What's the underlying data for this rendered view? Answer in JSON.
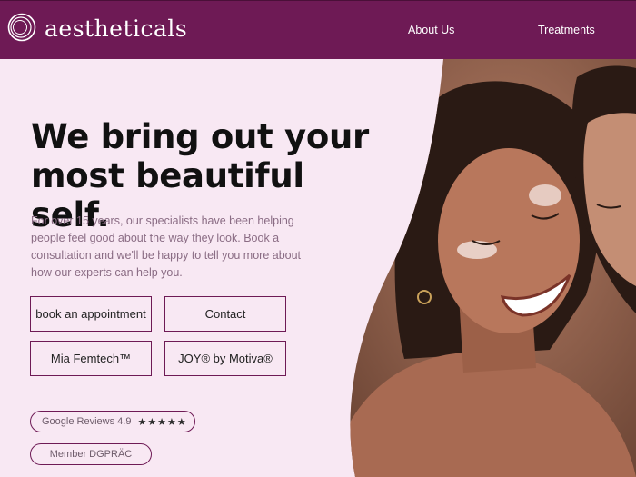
{
  "header": {
    "brand": "aestheticals",
    "nav": [
      {
        "label": "About Us"
      },
      {
        "label": "Treatments"
      }
    ]
  },
  "hero": {
    "headline_line1": "We bring out your",
    "headline_line2": "most beautiful self.",
    "intro": "For over 15 years, our specialists have been helping people feel good about the way they look. Book a consultation and we'll be happy to tell you more about how our experts can help you."
  },
  "buttons": {
    "book": "book an appointment",
    "contact": "Contact",
    "femtech": "Mia Femtech™",
    "joy": "JOY® by Motiva®"
  },
  "badges": {
    "reviews_label": "Google Reviews 4.9",
    "rating": 4.9,
    "stars": "★★★★★",
    "member": "Member DGPRÄC"
  },
  "colors": {
    "brand": "#6e1a55",
    "background": "#f8e8f3",
    "headline": "#111111",
    "body_text": "#8a6c84"
  },
  "icons": {
    "logo": "concentric-rings-logo-icon",
    "rating": "star-icon"
  }
}
